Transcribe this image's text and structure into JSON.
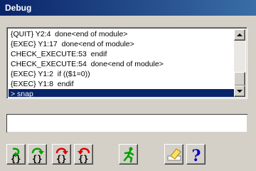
{
  "window": {
    "title": "Debug"
  },
  "log": {
    "lines": [
      "{QUIT} Y2:4  done<end of module>",
      "{EXEC} Y1:17  done<end of module>",
      "CHECK_EXECUTE:53  endif",
      "CHECK_EXECUTE:54  done<end of module>",
      "{EXEC} Y1:2  if (($1=0))",
      "{EXEC} Y1:8  endif",
      "> snap"
    ],
    "selected_index": 6
  },
  "command": {
    "value": "",
    "placeholder": ""
  },
  "toolbar": {
    "buttons": [
      {
        "name": "step-into-button",
        "icon": "step-into-icon"
      },
      {
        "name": "step-over-button",
        "icon": "step-over-icon"
      },
      {
        "name": "step-out-button",
        "icon": "step-out-icon"
      },
      {
        "name": "step-back-button",
        "icon": "step-back-icon"
      },
      {
        "name": "run-button",
        "icon": "running-man-icon"
      },
      {
        "name": "clear-button",
        "icon": "eraser-icon"
      },
      {
        "name": "help-button",
        "icon": "question-icon"
      }
    ]
  },
  "colors": {
    "title_bar": "#0a246a",
    "selection": "#0a246a",
    "arrow_green": "#00a000",
    "arrow_red": "#e00000",
    "help_blue": "#0000c8"
  }
}
